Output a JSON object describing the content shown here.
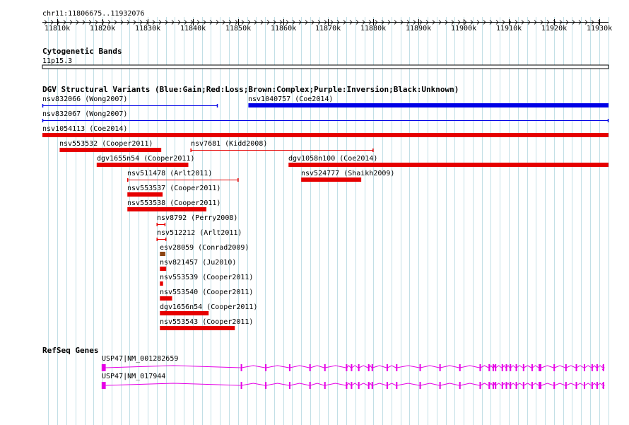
{
  "browser": {
    "location": "chr11:11806675..11932076",
    "range_start": 11806675,
    "range_end": 11932076,
    "ticks": [
      "11810k",
      "11820k",
      "11830k",
      "11840k",
      "11850k",
      "11860k",
      "11870k",
      "11880k",
      "11890k",
      "11900k",
      "11910k",
      "11920k",
      "11930k"
    ],
    "tick_values": [
      11810000,
      11820000,
      11830000,
      11840000,
      11850000,
      11860000,
      11870000,
      11880000,
      11890000,
      11900000,
      11910000,
      11920000,
      11930000
    ]
  },
  "colors": {
    "grid": "#c2dfe6",
    "gain": "#0000e6",
    "loss": "#e60000",
    "complex": "#8b4513",
    "gene": "#e600e6"
  },
  "tracks": {
    "cyto": {
      "title": "Cytogenetic Bands",
      "band": "11p15.3"
    },
    "dgv": {
      "title": "DGV Structural Variants (Blue:Gain;Red:Loss;Brown:Complex;Purple:Inversion;Black:Unknown)",
      "variants": [
        {
          "id": "nsv832066",
          "label": "nsv832066 (Wong2007)",
          "start": 11806675,
          "end": 11845500,
          "color": "gain",
          "style": "thin"
        },
        {
          "id": "nsv1040757",
          "label": "nsv1040757 (Coe2014)",
          "start": 11852300,
          "end": 11932076,
          "color": "gain",
          "style": "thick"
        },
        {
          "id": "nsv832067",
          "label": "nsv832067 (Wong2007)",
          "start": 11806675,
          "end": 11932076,
          "color": "gain",
          "style": "thin"
        },
        {
          "id": "nsv1054113",
          "label": "nsv1054113 (Coe2014)",
          "start": 11806675,
          "end": 11932076,
          "color": "loss",
          "style": "thick"
        },
        {
          "id": "nsv553532",
          "label": "nsv553532 (Cooper2011)",
          "start": 11810500,
          "end": 11833000,
          "color": "loss",
          "style": "thick"
        },
        {
          "id": "nsv7681",
          "label": "nsv7681 (Kidd2008)",
          "start": 11839500,
          "end": 11880000,
          "color": "loss",
          "style": "thin"
        },
        {
          "id": "dgv1655n54",
          "label": "dgv1655n54 (Cooper2011)",
          "start": 11818700,
          "end": 11839000,
          "color": "loss",
          "style": "thick"
        },
        {
          "id": "dgv1058n100",
          "label": "dgv1058n100 (Coe2014)",
          "start": 11861200,
          "end": 11932076,
          "color": "loss",
          "style": "thick"
        },
        {
          "id": "nsv511478",
          "label": "nsv511478 (Arlt2011)",
          "start": 11825500,
          "end": 11850100,
          "color": "loss",
          "style": "thin"
        },
        {
          "id": "nsv524777",
          "label": "nsv524777 (Shaikh2009)",
          "start": 11864000,
          "end": 11877300,
          "color": "loss",
          "style": "thick"
        },
        {
          "id": "nsv553537",
          "label": "nsv553537 (Cooper2011)",
          "start": 11825500,
          "end": 11833300,
          "color": "loss",
          "style": "thick"
        },
        {
          "id": "nsv553538",
          "label": "nsv553538 (Cooper2011)",
          "start": 11825500,
          "end": 11843000,
          "color": "loss",
          "style": "thick"
        },
        {
          "id": "nsv8792",
          "label": "nsv8792 (Perry2008)",
          "start": 11832000,
          "end": 11833900,
          "color": "loss",
          "style": "thin"
        },
        {
          "id": "nsv512212",
          "label": "nsv512212 (Arlt2011)",
          "start": 11832000,
          "end": 11834100,
          "color": "loss",
          "style": "thin"
        },
        {
          "id": "esv28059",
          "label": "esv28059 (Conrad2009)",
          "start": 11832700,
          "end": 11833900,
          "color": "complex",
          "style": "thick"
        },
        {
          "id": "nsv821457",
          "label": "nsv821457 (Ju2010)",
          "start": 11832700,
          "end": 11834100,
          "color": "loss",
          "style": "thick"
        },
        {
          "id": "nsv553539",
          "label": "nsv553539 (Cooper2011)",
          "start": 11832700,
          "end": 11833400,
          "color": "loss",
          "style": "thick"
        },
        {
          "id": "nsv553540",
          "label": "nsv553540 (Cooper2011)",
          "start": 11832700,
          "end": 11835400,
          "color": "loss",
          "style": "thick"
        },
        {
          "id": "dgv1656n54",
          "label": "dgv1656n54 (Cooper2011)",
          "start": 11832700,
          "end": 11843500,
          "color": "loss",
          "style": "thick"
        },
        {
          "id": "nsv553543",
          "label": "nsv553543 (Cooper2011)",
          "start": 11832700,
          "end": 11849300,
          "color": "loss",
          "style": "thick"
        }
      ]
    },
    "genes": {
      "title": "RefSeq Genes",
      "items": [
        {
          "label": "USP47|NM_001282659",
          "start": 11819800,
          "end": 11932076,
          "exons": [
            [
              11819800,
              11820700
            ],
            [
              11850600,
              11850800
            ],
            [
              11856000,
              11856200
            ],
            [
              11861300,
              11861500
            ],
            [
              11865800,
              11866000
            ],
            [
              11869100,
              11869300
            ],
            [
              11873900,
              11874100
            ],
            [
              11875000,
              11875200
            ],
            [
              11876600,
              11876800
            ],
            [
              11878800,
              11879000
            ],
            [
              11879600,
              11879800
            ],
            [
              11882900,
              11883100
            ],
            [
              11885000,
              11885200
            ],
            [
              11890200,
              11890400
            ],
            [
              11894600,
              11894800
            ],
            [
              11899000,
              11899200
            ],
            [
              11903500,
              11903700
            ],
            [
              11905500,
              11905700
            ],
            [
              11906400,
              11906600
            ],
            [
              11906900,
              11907100
            ],
            [
              11908400,
              11908600
            ],
            [
              11909300,
              11909500
            ],
            [
              11910200,
              11910400
            ],
            [
              11911500,
              11911700
            ],
            [
              11913100,
              11913300
            ],
            [
              11915000,
              11915200
            ],
            [
              11916600,
              11917200
            ],
            [
              11919900,
              11920100
            ],
            [
              11922500,
              11922700
            ],
            [
              11924800,
              11925000
            ],
            [
              11926600,
              11926800
            ],
            [
              11928300,
              11928500
            ],
            [
              11929400,
              11929600
            ],
            [
              11930800,
              11931000
            ]
          ]
        },
        {
          "label": "USP47|NM_017944",
          "start": 11819800,
          "end": 11932076,
          "exons": [
            [
              11819800,
              11820700
            ],
            [
              11850600,
              11850800
            ],
            [
              11856000,
              11856200
            ],
            [
              11861300,
              11861500
            ],
            [
              11865800,
              11866000
            ],
            [
              11869100,
              11869300
            ],
            [
              11873900,
              11874100
            ],
            [
              11875000,
              11875200
            ],
            [
              11876600,
              11876800
            ],
            [
              11878800,
              11879000
            ],
            [
              11879600,
              11879800
            ],
            [
              11882900,
              11883100
            ],
            [
              11885000,
              11885200
            ],
            [
              11890200,
              11890400
            ],
            [
              11894600,
              11894800
            ],
            [
              11899000,
              11899200
            ],
            [
              11903500,
              11903700
            ],
            [
              11905500,
              11905700
            ],
            [
              11906400,
              11906600
            ],
            [
              11906900,
              11907100
            ],
            [
              11908400,
              11908600
            ],
            [
              11909300,
              11909500
            ],
            [
              11910200,
              11910400
            ],
            [
              11911500,
              11911700
            ],
            [
              11913100,
              11913300
            ],
            [
              11915000,
              11915200
            ],
            [
              11916600,
              11917200
            ],
            [
              11919900,
              11920100
            ],
            [
              11922500,
              11922700
            ],
            [
              11924800,
              11925000
            ],
            [
              11926600,
              11926800
            ],
            [
              11928300,
              11928500
            ],
            [
              11929400,
              11929600
            ],
            [
              11930800,
              11931000
            ]
          ]
        }
      ]
    }
  }
}
